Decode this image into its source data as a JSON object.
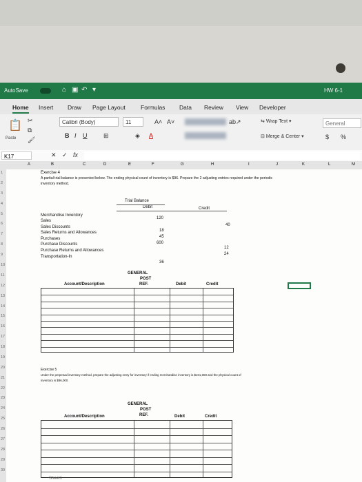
{
  "window": {
    "autosave": "AutoSave",
    "toggle": "OFF",
    "doc_name": "HW 6-1"
  },
  "tabs": [
    "Home",
    "Insert",
    "Draw",
    "Page Layout",
    "Formulas",
    "Data",
    "Review",
    "View",
    "Developer"
  ],
  "ribbon": {
    "paste": "Paste",
    "font_name": "Calibri (Body)",
    "font_size": "11",
    "bold": "B",
    "italic": "I",
    "underline": "U",
    "wrap_text": "Wrap Text",
    "merge_center": "Merge & Center",
    "number_format": "General",
    "currency": "$",
    "percent": "%"
  },
  "formula_bar": {
    "name_box": "K17",
    "fx": "fx",
    "cancel": "✕",
    "enter": "✓"
  },
  "columns": [
    "A",
    "B",
    "C",
    "D",
    "E",
    "F",
    "G",
    "H",
    "I",
    "J",
    "K",
    "L",
    "M"
  ],
  "rows": [
    "1",
    "2",
    "3",
    "4",
    "5",
    "6",
    "7",
    "8",
    "9",
    "10",
    "11",
    "12",
    "13",
    "14",
    "15",
    "16",
    "17",
    "18",
    "19",
    "20",
    "21",
    "22",
    "23",
    "24",
    "25",
    "26",
    "27",
    "28",
    "29",
    "30"
  ],
  "exercise4": {
    "title": "Exercise 4",
    "desc1": "A partial trial balance is presented below. The ending physical count of inventory is $96. Prepare the 2 adjusting entries required under the periodic",
    "desc2": "inventory method.",
    "tb_title": "Trial Balance",
    "debit": "Debit",
    "credit": "Credit",
    "accounts": [
      {
        "name": "Merchandise Inventory",
        "debit": "120",
        "credit": ""
      },
      {
        "name": "Sales",
        "debit": "",
        "credit": "40"
      },
      {
        "name": "Sales Discounts",
        "debit": "18",
        "credit": ""
      },
      {
        "name": "Sales Returns and Allowances",
        "debit": "45",
        "credit": ""
      },
      {
        "name": "Purchases",
        "debit": "600",
        "credit": ""
      },
      {
        "name": "Purchase Discounts",
        "debit": "",
        "credit": "12"
      },
      {
        "name": "Purchase Returns and Allowances",
        "debit": "",
        "credit": "24"
      },
      {
        "name": "Transportation-In",
        "debit": "36",
        "credit": ""
      }
    ],
    "journal": {
      "general": "GENERAL",
      "post": "POST",
      "ref": "REF.",
      "account_desc": "Account/Description",
      "debit": "Debit",
      "credit": "Credit"
    }
  },
  "exercise5": {
    "title": "Exercise 5",
    "desc1": "Under the perpetual inventory method, prepare the adjusting entry for inventory if ending merchandise inventory is $101,000 and the physical count of",
    "desc2": "inventory is $96,000.",
    "journal": {
      "general": "GENERAL",
      "post": "POST",
      "ref": "REF.",
      "account_desc": "Account/Description",
      "debit": "Debit",
      "credit": "Credit"
    }
  },
  "sheet_tab": "Sheet1"
}
